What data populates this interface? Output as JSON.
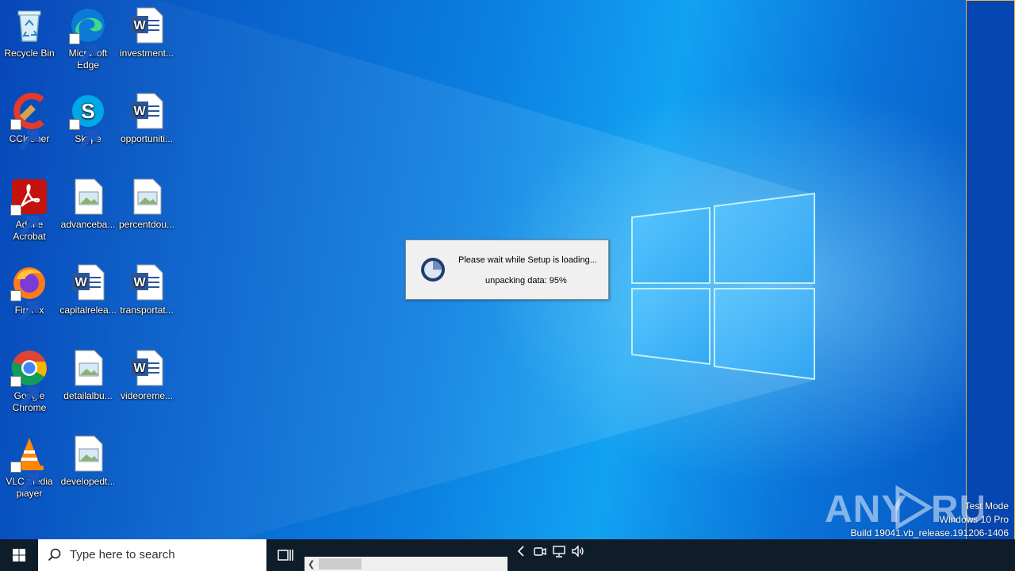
{
  "desktop_icons": [
    {
      "id": "recycle-bin",
      "label": "Recycle Bin",
      "icon": "recycle-bin-icon"
    },
    {
      "id": "microsoft-edge",
      "label": "Microsoft Edge",
      "icon": "edge-icon"
    },
    {
      "id": "investment",
      "label": "investment...",
      "icon": "word-doc-icon"
    },
    {
      "id": "ccleaner",
      "label": "CCleaner",
      "icon": "ccleaner-icon"
    },
    {
      "id": "skype",
      "label": "Skype",
      "icon": "skype-icon"
    },
    {
      "id": "opportuniti",
      "label": "opportuniti...",
      "icon": "word-doc-icon"
    },
    {
      "id": "adobe-acrobat",
      "label": "Adobe Acrobat",
      "icon": "acrobat-icon"
    },
    {
      "id": "advanceba",
      "label": "advanceba...",
      "icon": "image-file-icon"
    },
    {
      "id": "percentdou",
      "label": "percentdou...",
      "icon": "image-file-icon"
    },
    {
      "id": "firefox",
      "label": "Firefox",
      "icon": "firefox-icon"
    },
    {
      "id": "capitalrelea",
      "label": "capitalrelea...",
      "icon": "word-doc-icon"
    },
    {
      "id": "transportat",
      "label": "transportat...",
      "icon": "word-doc-icon"
    },
    {
      "id": "google-chrome",
      "label": "Google Chrome",
      "icon": "chrome-icon"
    },
    {
      "id": "detailalbu",
      "label": "detailalbu...",
      "icon": "image-file-icon"
    },
    {
      "id": "videoreme",
      "label": "videoreme...",
      "icon": "word-doc-icon"
    },
    {
      "id": "vlc",
      "label": "VLC media player",
      "icon": "vlc-icon"
    },
    {
      "id": "developedt",
      "label": "developedt...",
      "icon": "image-file-icon"
    }
  ],
  "dialog": {
    "message": "Please wait while Setup is loading...",
    "status": "unpacking data: 95%",
    "progress_percent": 95
  },
  "watermark": {
    "brand": "ANY RUN",
    "line1": "Test Mode",
    "line2": "Windows 10 Pro",
    "line3": "Build 19041.vb_release.191206-1406"
  },
  "taskbar": {
    "search_placeholder": "Type here to search"
  },
  "colors": {
    "taskbar": "#0f1c2a",
    "wallpaper_accent": "#12a2f2",
    "dialog_bg": "#f0f0f0"
  }
}
